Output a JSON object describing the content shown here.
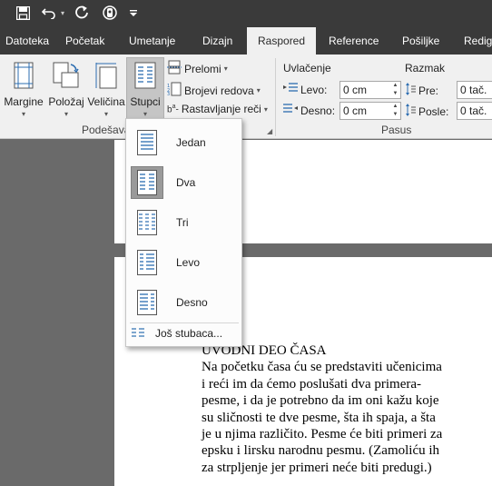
{
  "quick_access": {
    "icons": [
      "save-icon",
      "undo-icon",
      "redo-icon",
      "touch-mode-icon",
      "customize-icon"
    ]
  },
  "tabs": [
    {
      "label": "Datoteka"
    },
    {
      "label": "Početak"
    },
    {
      "label": "Umetanje"
    },
    {
      "label": "Dizajn"
    },
    {
      "label": "Raspored",
      "active": true
    },
    {
      "label": "Reference"
    },
    {
      "label": "Pošiljke"
    },
    {
      "label": "Redig"
    }
  ],
  "ribbon": {
    "margine": "Margine",
    "polozaj": "Položaj",
    "velicina": "Veličina",
    "stupci": "Stupci",
    "prelomi": "Prelomi",
    "brojevi_redova": "Brojevi redova",
    "rastavljanje": "Rastavljanje reči",
    "group_podesavanje": "Podešavanje stranice",
    "uvlacenje": "Uvlačenje",
    "levo_label": "Levo:",
    "levo_value": "0 cm",
    "desno_label": "Desno:",
    "desno_value": "0 cm",
    "razmak": "Razmak",
    "pre_label": "Pre:",
    "pre_value": "0 tač.",
    "posle_label": "Posle:",
    "posle_value": "0 tač.",
    "group_pasus": "Pasus"
  },
  "columns_menu": {
    "items": [
      {
        "label": "Jedan",
        "selected": false
      },
      {
        "label": "Dva",
        "selected": true
      },
      {
        "label": "Tri",
        "selected": false
      },
      {
        "label": "Levo",
        "selected": false
      },
      {
        "label": "Desno",
        "selected": false
      }
    ],
    "more": "Još stubaca..."
  },
  "document": {
    "lines": [
      "UVODNI DEO ČASA",
      "Na početku časa ću se predstaviti učenicima",
      "i reći im da ćemo poslušati dva primera-",
      "pesme, i da je potrebno da im oni kažu koje",
      "su sličnosti te dve pesme, šta ih spaja, a šta",
      "je u njima različito. Pesme će biti primeri za",
      "epsku i lirsku narodnu pesmu. (Zamoliću ih",
      "za strpljenje jer primeri neće biti predugi.)"
    ]
  }
}
